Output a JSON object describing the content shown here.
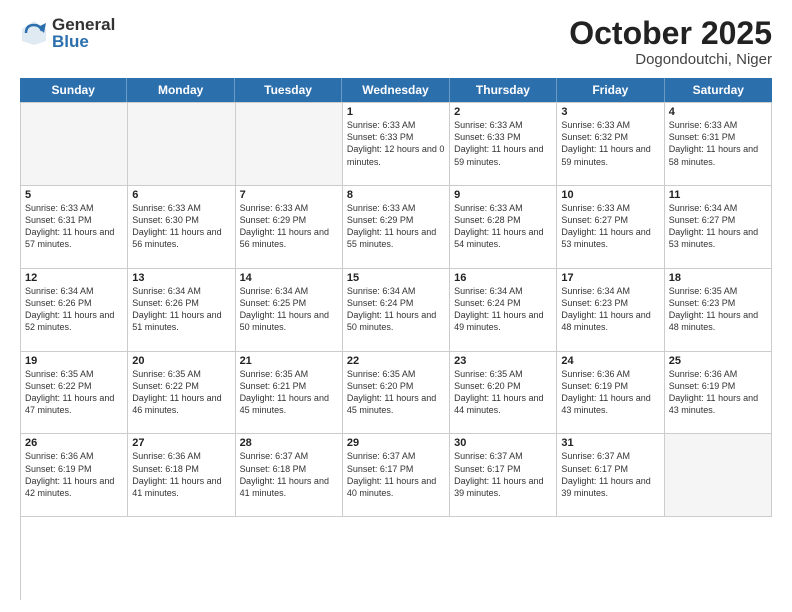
{
  "header": {
    "logo_general": "General",
    "logo_blue": "Blue",
    "month_title": "October 2025",
    "location": "Dogondoutchi, Niger"
  },
  "days_of_week": [
    "Sunday",
    "Monday",
    "Tuesday",
    "Wednesday",
    "Thursday",
    "Friday",
    "Saturday"
  ],
  "weeks": [
    [
      {
        "day": "",
        "info": "",
        "empty": true
      },
      {
        "day": "",
        "info": "",
        "empty": true
      },
      {
        "day": "",
        "info": "",
        "empty": true
      },
      {
        "day": "1",
        "info": "Sunrise: 6:33 AM\nSunset: 6:33 PM\nDaylight: 12 hours\nand 0 minutes."
      },
      {
        "day": "2",
        "info": "Sunrise: 6:33 AM\nSunset: 6:33 PM\nDaylight: 11 hours\nand 59 minutes."
      },
      {
        "day": "3",
        "info": "Sunrise: 6:33 AM\nSunset: 6:32 PM\nDaylight: 11 hours\nand 59 minutes."
      },
      {
        "day": "4",
        "info": "Sunrise: 6:33 AM\nSunset: 6:31 PM\nDaylight: 11 hours\nand 58 minutes."
      }
    ],
    [
      {
        "day": "5",
        "info": "Sunrise: 6:33 AM\nSunset: 6:31 PM\nDaylight: 11 hours\nand 57 minutes."
      },
      {
        "day": "6",
        "info": "Sunrise: 6:33 AM\nSunset: 6:30 PM\nDaylight: 11 hours\nand 56 minutes."
      },
      {
        "day": "7",
        "info": "Sunrise: 6:33 AM\nSunset: 6:29 PM\nDaylight: 11 hours\nand 56 minutes."
      },
      {
        "day": "8",
        "info": "Sunrise: 6:33 AM\nSunset: 6:29 PM\nDaylight: 11 hours\nand 55 minutes."
      },
      {
        "day": "9",
        "info": "Sunrise: 6:33 AM\nSunset: 6:28 PM\nDaylight: 11 hours\nand 54 minutes."
      },
      {
        "day": "10",
        "info": "Sunrise: 6:33 AM\nSunset: 6:27 PM\nDaylight: 11 hours\nand 53 minutes."
      },
      {
        "day": "11",
        "info": "Sunrise: 6:34 AM\nSunset: 6:27 PM\nDaylight: 11 hours\nand 53 minutes."
      }
    ],
    [
      {
        "day": "12",
        "info": "Sunrise: 6:34 AM\nSunset: 6:26 PM\nDaylight: 11 hours\nand 52 minutes."
      },
      {
        "day": "13",
        "info": "Sunrise: 6:34 AM\nSunset: 6:26 PM\nDaylight: 11 hours\nand 51 minutes."
      },
      {
        "day": "14",
        "info": "Sunrise: 6:34 AM\nSunset: 6:25 PM\nDaylight: 11 hours\nand 50 minutes."
      },
      {
        "day": "15",
        "info": "Sunrise: 6:34 AM\nSunset: 6:24 PM\nDaylight: 11 hours\nand 50 minutes."
      },
      {
        "day": "16",
        "info": "Sunrise: 6:34 AM\nSunset: 6:24 PM\nDaylight: 11 hours\nand 49 minutes."
      },
      {
        "day": "17",
        "info": "Sunrise: 6:34 AM\nSunset: 6:23 PM\nDaylight: 11 hours\nand 48 minutes."
      },
      {
        "day": "18",
        "info": "Sunrise: 6:35 AM\nSunset: 6:23 PM\nDaylight: 11 hours\nand 48 minutes."
      }
    ],
    [
      {
        "day": "19",
        "info": "Sunrise: 6:35 AM\nSunset: 6:22 PM\nDaylight: 11 hours\nand 47 minutes."
      },
      {
        "day": "20",
        "info": "Sunrise: 6:35 AM\nSunset: 6:22 PM\nDaylight: 11 hours\nand 46 minutes."
      },
      {
        "day": "21",
        "info": "Sunrise: 6:35 AM\nSunset: 6:21 PM\nDaylight: 11 hours\nand 45 minutes."
      },
      {
        "day": "22",
        "info": "Sunrise: 6:35 AM\nSunset: 6:20 PM\nDaylight: 11 hours\nand 45 minutes."
      },
      {
        "day": "23",
        "info": "Sunrise: 6:35 AM\nSunset: 6:20 PM\nDaylight: 11 hours\nand 44 minutes."
      },
      {
        "day": "24",
        "info": "Sunrise: 6:36 AM\nSunset: 6:19 PM\nDaylight: 11 hours\nand 43 minutes."
      },
      {
        "day": "25",
        "info": "Sunrise: 6:36 AM\nSunset: 6:19 PM\nDaylight: 11 hours\nand 43 minutes."
      }
    ],
    [
      {
        "day": "26",
        "info": "Sunrise: 6:36 AM\nSunset: 6:19 PM\nDaylight: 11 hours\nand 42 minutes."
      },
      {
        "day": "27",
        "info": "Sunrise: 6:36 AM\nSunset: 6:18 PM\nDaylight: 11 hours\nand 41 minutes."
      },
      {
        "day": "28",
        "info": "Sunrise: 6:37 AM\nSunset: 6:18 PM\nDaylight: 11 hours\nand 41 minutes."
      },
      {
        "day": "29",
        "info": "Sunrise: 6:37 AM\nSunset: 6:17 PM\nDaylight: 11 hours\nand 40 minutes."
      },
      {
        "day": "30",
        "info": "Sunrise: 6:37 AM\nSunset: 6:17 PM\nDaylight: 11 hours\nand 39 minutes."
      },
      {
        "day": "31",
        "info": "Sunrise: 6:37 AM\nSunset: 6:17 PM\nDaylight: 11 hours\nand 39 minutes."
      },
      {
        "day": "",
        "info": "",
        "empty": true
      }
    ]
  ]
}
